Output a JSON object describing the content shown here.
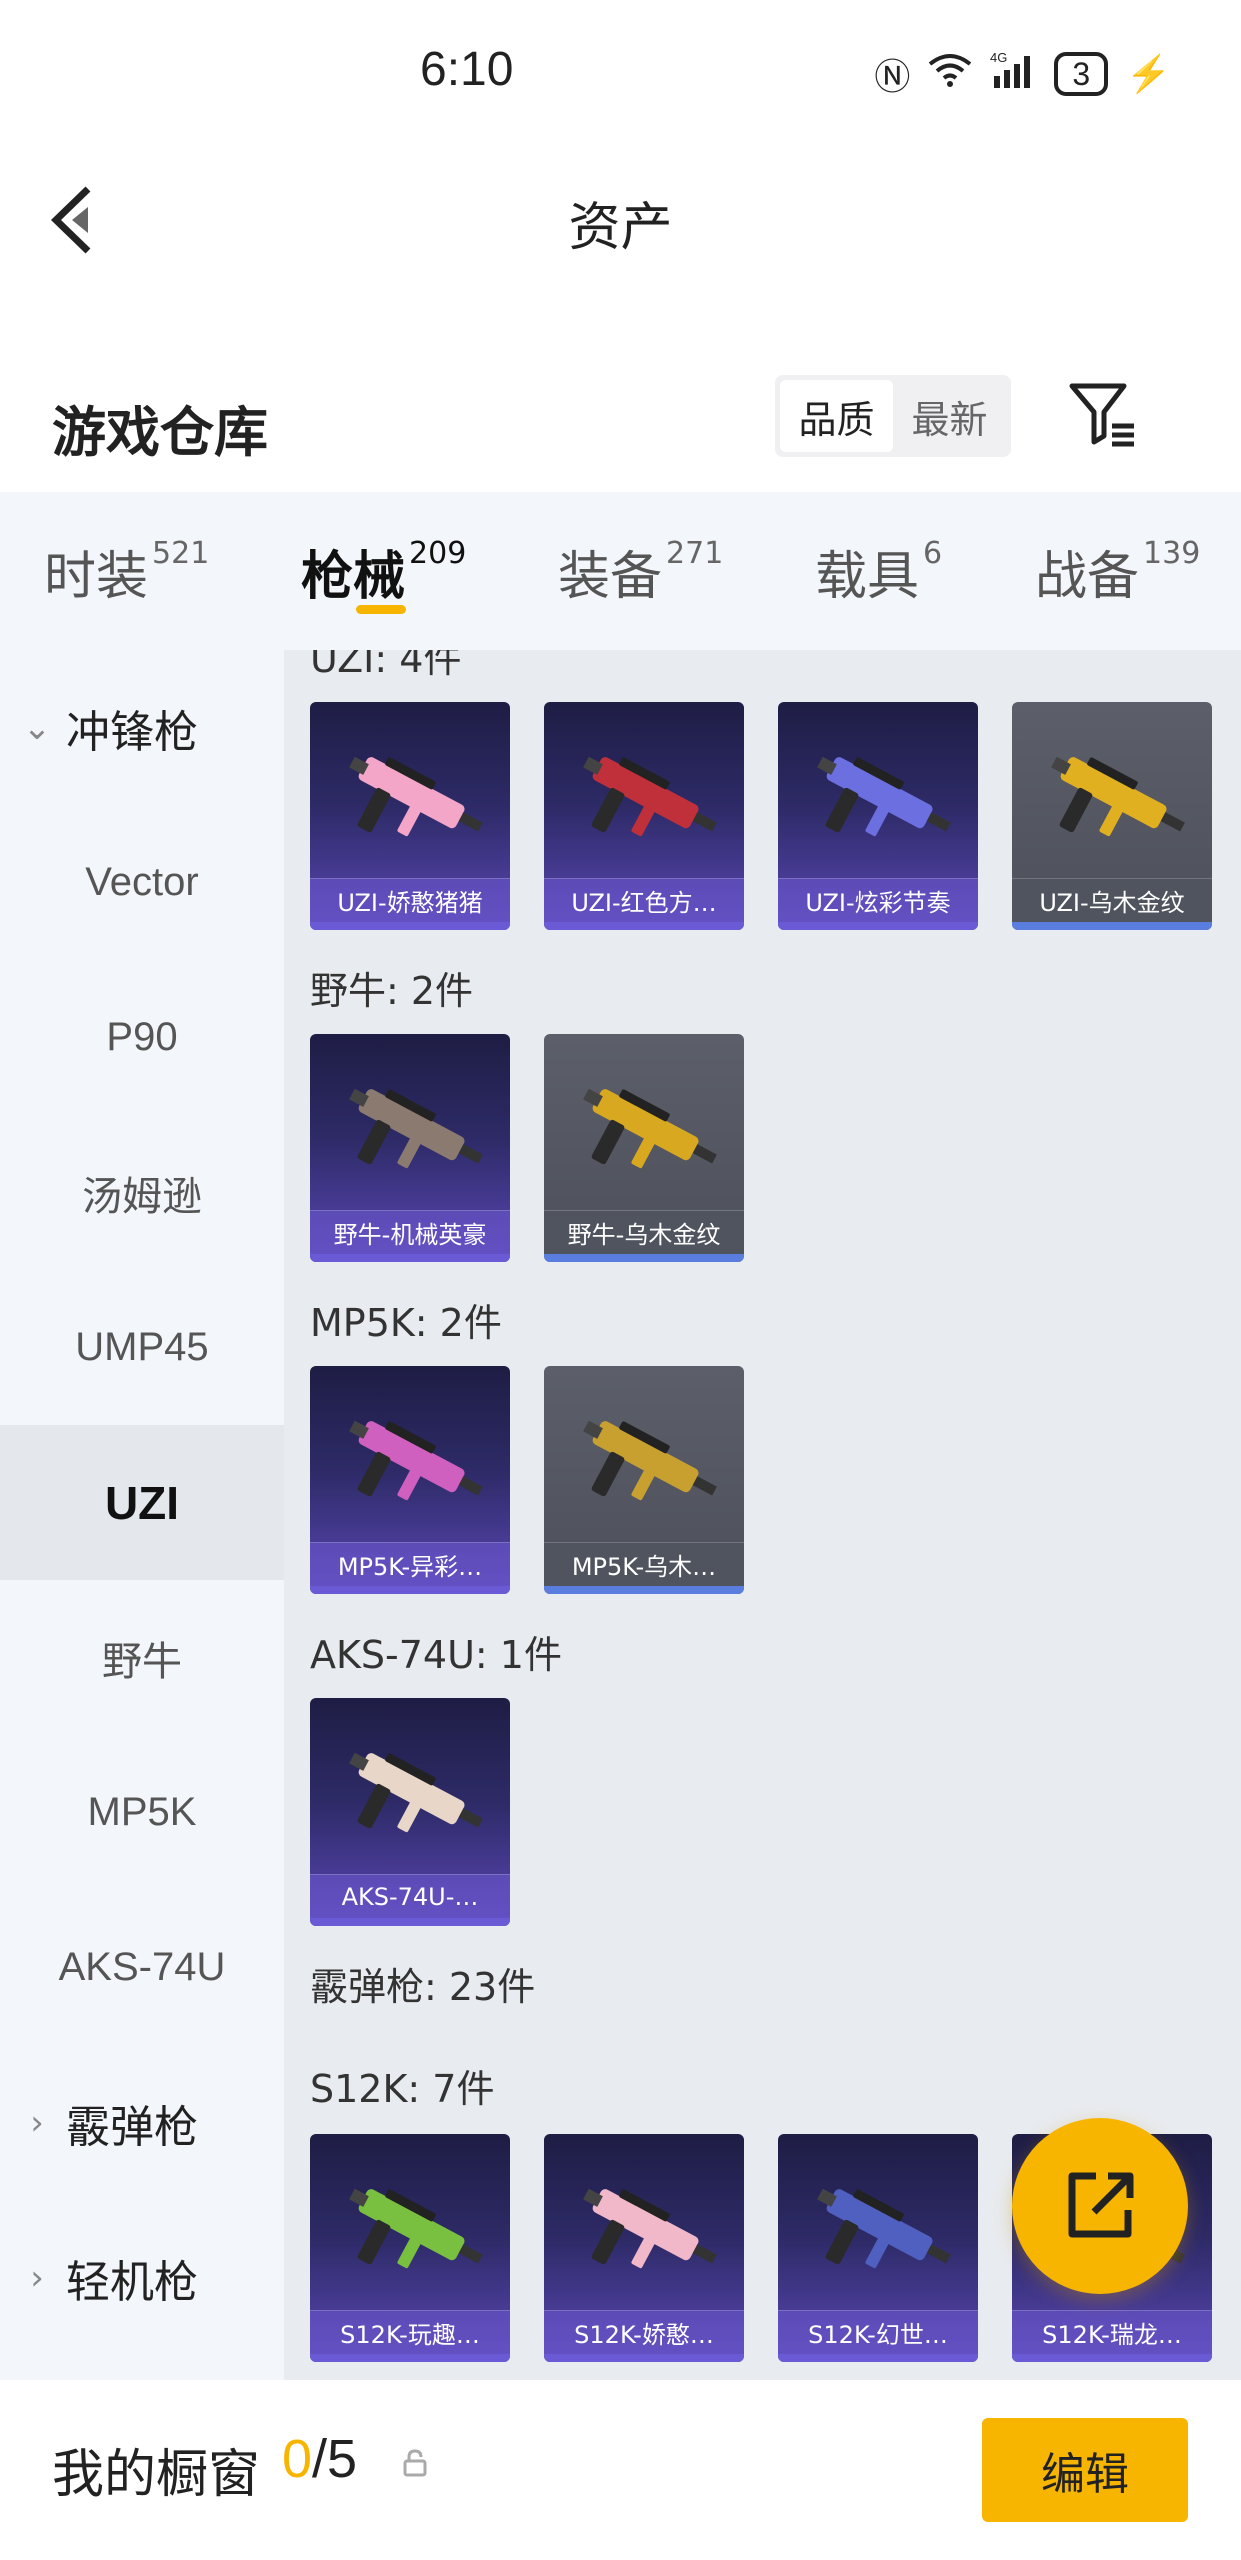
{
  "status": {
    "time": "6:10",
    "network": "4G",
    "battery": "3"
  },
  "header": {
    "title": "资产"
  },
  "warehouse": {
    "title": "游戏仓库",
    "sort_options": [
      "品质",
      "最新"
    ],
    "active_sort": "品质"
  },
  "categories": [
    {
      "name": "时装",
      "count": "521"
    },
    {
      "name": "枪械",
      "count": "209"
    },
    {
      "name": "装备",
      "count": "271"
    },
    {
      "name": "载具",
      "count": "6"
    },
    {
      "name": "战备",
      "count": "139"
    }
  ],
  "sidebar": {
    "items": [
      {
        "label": "冲锋枪",
        "type": "group",
        "expanded": true
      },
      {
        "label": "Vector",
        "type": "item"
      },
      {
        "label": "P90",
        "type": "item"
      },
      {
        "label": "汤姆逊",
        "type": "item"
      },
      {
        "label": "UMP45",
        "type": "item"
      },
      {
        "label": "UZI",
        "type": "item",
        "active": true
      },
      {
        "label": "野牛",
        "type": "item"
      },
      {
        "label": "MP5K",
        "type": "item"
      },
      {
        "label": "AKS-74U",
        "type": "item"
      },
      {
        "label": "霰弹枪",
        "type": "group",
        "expanded": false
      },
      {
        "label": "轻机枪",
        "type": "group",
        "expanded": false
      }
    ]
  },
  "sections": [
    {
      "label": "UZI: 4件",
      "items": [
        {
          "name": "UZI-娇憨猪猪",
          "rarity": "purple",
          "color": "#f4a6c9"
        },
        {
          "name": "UZI-红色方…",
          "rarity": "purple",
          "color": "#c0303a"
        },
        {
          "name": "UZI-炫彩节奏",
          "rarity": "purple",
          "color": "#6b6fe0"
        },
        {
          "name": "UZI-乌木金纹",
          "rarity": "gray",
          "color": "#e0b020"
        }
      ]
    },
    {
      "label": "野牛: 2件",
      "items": [
        {
          "name": "野牛-机械英豪",
          "rarity": "purple",
          "color": "#8a7a70"
        },
        {
          "name": "野牛-乌木金纹",
          "rarity": "gray",
          "color": "#d8a820"
        }
      ]
    },
    {
      "label": "MP5K: 2件",
      "items": [
        {
          "name": "MP5K-异彩…",
          "rarity": "purple",
          "color": "#d060c0"
        },
        {
          "name": "MP5K-乌木…",
          "rarity": "gray",
          "color": "#c8a030"
        }
      ]
    },
    {
      "label": "AKS-74U: 1件",
      "items": [
        {
          "name": "AKS-74U-…",
          "rarity": "purple",
          "color": "#e8d6c8"
        }
      ]
    },
    {
      "label": "霰弹枪: 23件",
      "items": []
    },
    {
      "label": "S12K: 7件",
      "items": [
        {
          "name": "S12K-玩趣…",
          "rarity": "purple",
          "color": "#7ac040"
        },
        {
          "name": "S12K-娇憨…",
          "rarity": "purple",
          "color": "#f0b8c8"
        },
        {
          "name": "S12K-幻世…",
          "rarity": "purple",
          "color": "#5060c0"
        },
        {
          "name": "S12K-瑞龙…",
          "rarity": "purple",
          "color": "#d88030"
        }
      ]
    }
  ],
  "bottom": {
    "title": "我的橱窗",
    "current": "0",
    "total": "/5",
    "edit_label": "编辑"
  },
  "colors": {
    "accent": "#f7b500",
    "purple_rarity": "#6a5ad6",
    "gray_rarity": "#5a7de0"
  }
}
